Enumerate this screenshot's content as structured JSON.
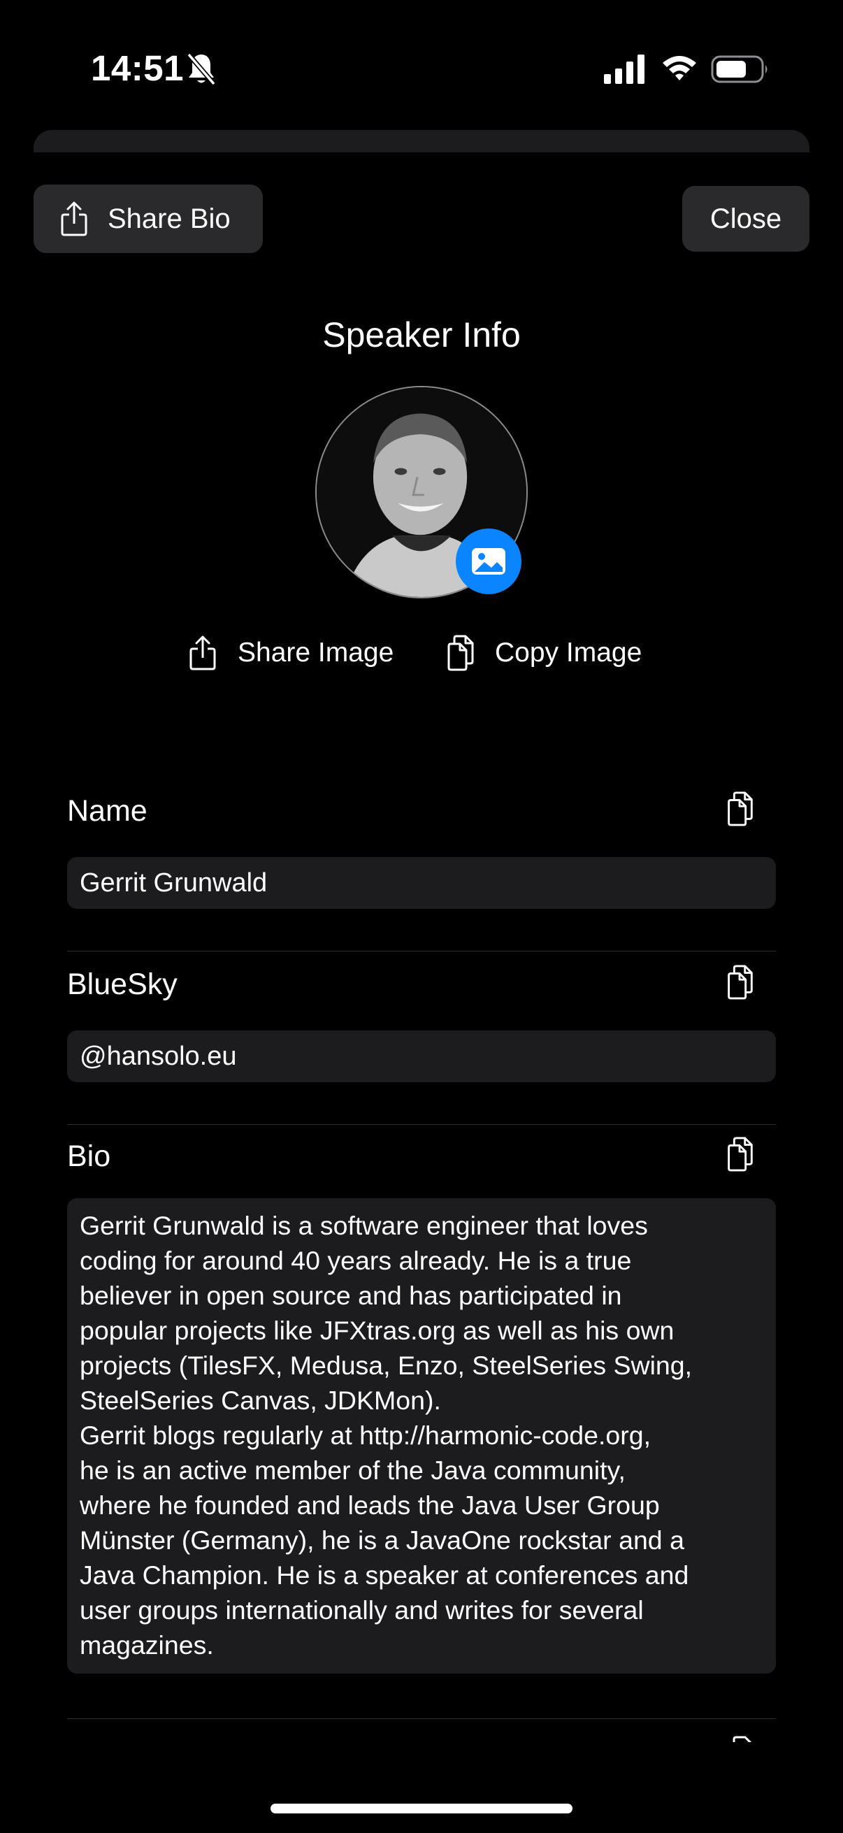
{
  "status_bar": {
    "time": "14:51",
    "icons": [
      "bell-slash-icon",
      "cellular-signal-icon",
      "wifi-icon",
      "battery-icon"
    ]
  },
  "toolbar": {
    "share_bio_label": "Share Bio",
    "share_bio_icon": "share-icon",
    "close_label": "Close"
  },
  "header": {
    "title": "Speaker Info"
  },
  "avatar": {
    "badge_icon": "photo-icon",
    "badge_color": "#0a84ff"
  },
  "image_actions": {
    "share_image_label": "Share Image",
    "copy_image_label": "Copy Image"
  },
  "fields": {
    "name": {
      "label": "Name",
      "value": "Gerrit Grunwald"
    },
    "bluesky": {
      "label": "BlueSky",
      "value": "@hansolo.eu"
    },
    "bio": {
      "label": "Bio",
      "value": "Gerrit Grunwald is a software engineer that loves\ncoding for around 40 years already. He is a true\nbeliever in open source and has participated in\npopular projects like JFXtras.org as well as his own\nprojects (TilesFX, Medusa, Enzo, SteelSeries Swing,\nSteelSeries Canvas, JDKMon).\nGerrit blogs regularly at http://harmonic-code.org,\nhe is an active member of the Java community,\nwhere he founded and leads the Java User Group\nMünster (Germany), he is a JavaOne rockstar and a\nJava Champion. He is a speaker at conferences and\nuser groups internationally and writes for several\nmagazines."
    }
  }
}
